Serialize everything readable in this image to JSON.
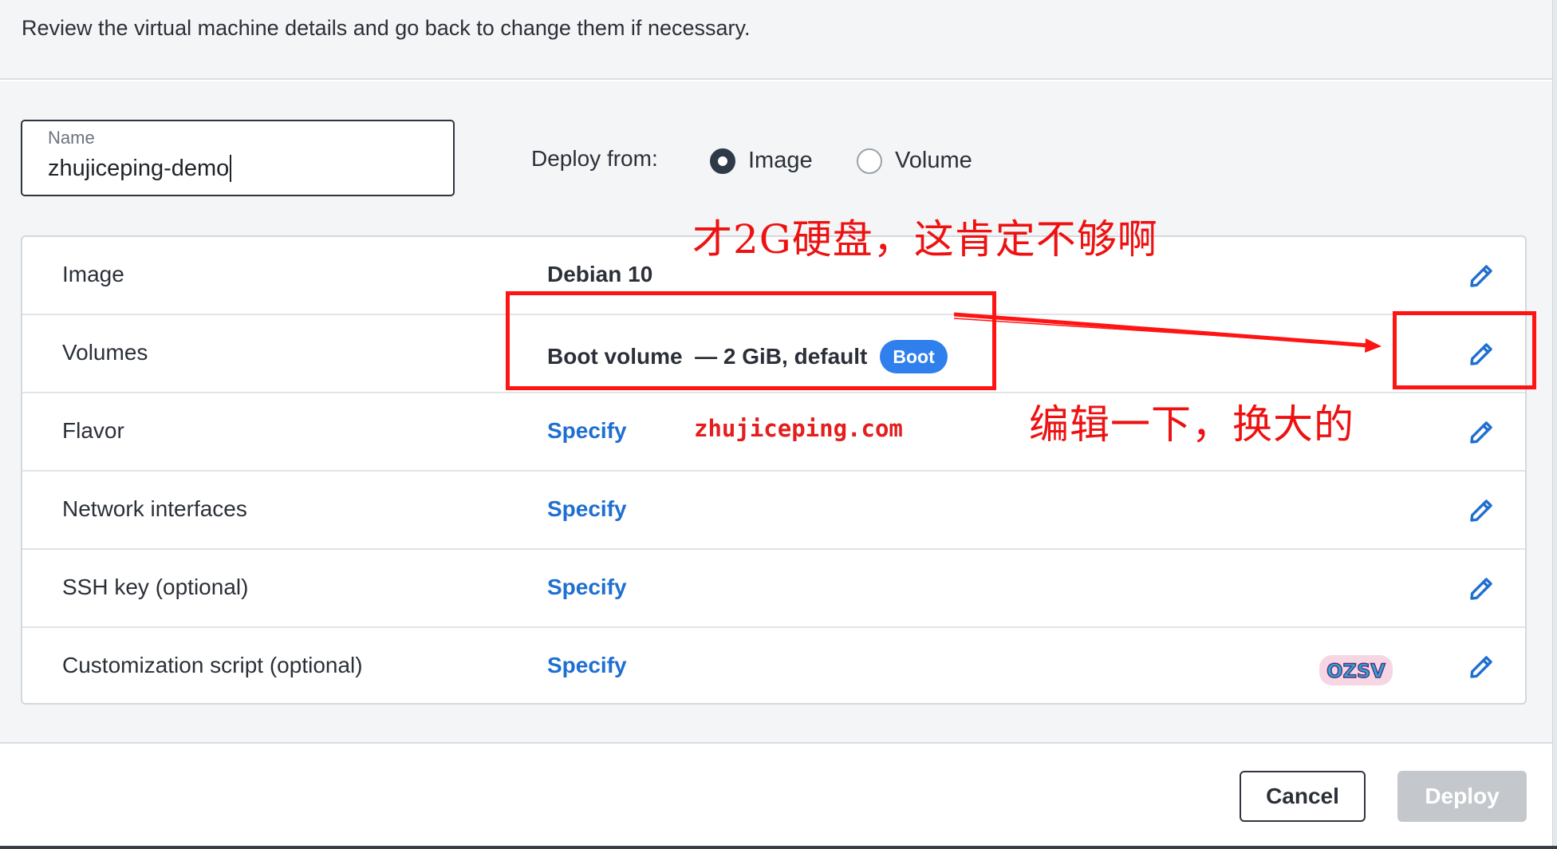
{
  "header": {
    "subtitle": "Review the virtual machine details and go back to change them if necessary."
  },
  "name_field": {
    "label": "Name",
    "value": "zhujiceping-demo"
  },
  "deploy_from": {
    "label": "Deploy from:",
    "options": [
      {
        "label": "Image",
        "selected": true
      },
      {
        "label": "Volume",
        "selected": false
      }
    ]
  },
  "summary": {
    "rows": [
      {
        "label": "Image",
        "value": "Debian 10",
        "is_link": false
      },
      {
        "label": "Volumes",
        "value": "Boot volume  — 2 GiB, default",
        "badge": "Boot",
        "is_link": false
      },
      {
        "label": "Flavor",
        "value": "Specify",
        "is_link": true
      },
      {
        "label": "Network interfaces",
        "value": "Specify",
        "is_link": true
      },
      {
        "label": "SSH key (optional)",
        "value": "Specify",
        "is_link": true
      },
      {
        "label": "Customization script (optional)",
        "value": "Specify",
        "is_link": true
      }
    ],
    "edit_icon": "pencil-icon"
  },
  "footer": {
    "cancel_label": "Cancel",
    "deploy_label": "Deploy"
  },
  "annotations": {
    "top_note": "才2G硬盘，这肯定不够啊",
    "right_note": "编辑一下，换大的",
    "watermark": "zhujiceping.com",
    "logo_text": "OZSV"
  },
  "colors": {
    "link": "#1f6fd1",
    "badge": "#2f80ed",
    "annotation_red": "#ff1414",
    "disabled_button": "#c4c8cd"
  }
}
